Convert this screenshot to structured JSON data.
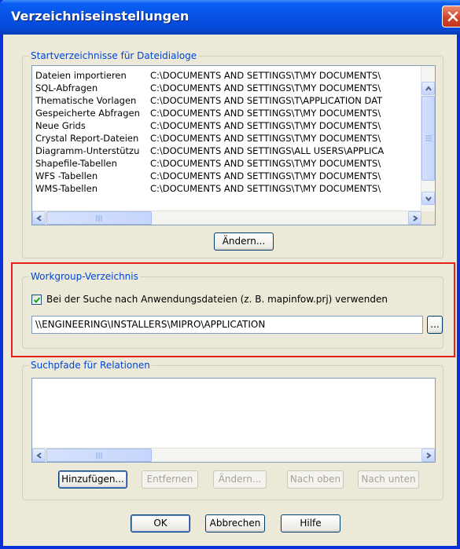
{
  "window": {
    "title": "Verzeichniseinstellungen"
  },
  "start_dirs": {
    "legend": "Startverzeichnisse für Dateidialoge",
    "rows": [
      {
        "name": "Dateien importieren",
        "path": "C:\\DOCUMENTS AND SETTINGS\\T\\MY DOCUMENTS\\"
      },
      {
        "name": "SQL-Abfragen",
        "path": "C:\\DOCUMENTS AND SETTINGS\\T\\MY DOCUMENTS\\"
      },
      {
        "name": "Thematische Vorlagen",
        "path": "C:\\DOCUMENTS AND SETTINGS\\T\\APPLICATION DAT"
      },
      {
        "name": "Gespeicherte Abfragen",
        "path": "C:\\DOCUMENTS AND SETTINGS\\T\\MY DOCUMENTS\\"
      },
      {
        "name": "Neue Grids",
        "path": "C:\\DOCUMENTS AND SETTINGS\\T\\MY DOCUMENTS\\"
      },
      {
        "name": "Crystal Report-Dateien",
        "path": "C:\\DOCUMENTS AND SETTINGS\\T\\MY DOCUMENTS\\"
      },
      {
        "name": "Diagramm-Unterstützu",
        "path": "C:\\DOCUMENTS AND SETTINGS\\ALL USERS\\APPLICA"
      },
      {
        "name": "Shapefile-Tabellen",
        "path": "C:\\DOCUMENTS AND SETTINGS\\T\\MY DOCUMENTS\\"
      },
      {
        "name": "WFS -Tabellen",
        "path": "C:\\DOCUMENTS AND SETTINGS\\T\\MY DOCUMENTS\\"
      },
      {
        "name": "WMS-Tabellen",
        "path": "C:\\DOCUMENTS AND SETTINGS\\T\\MY DOCUMENTS\\"
      }
    ],
    "change_button": "Ändern..."
  },
  "workgroup": {
    "legend": "Workgroup-Verzeichnis",
    "checkbox_label": "Bei der Suche nach Anwendungsdateien (z. B. mapinfow.prj) verwenden",
    "checked": true,
    "path": "\\\\ENGINEERING\\INSTALLERS\\MIPRO\\APPLICATION",
    "browse_button": "..."
  },
  "search_paths": {
    "legend": "Suchpfade für Relationen",
    "buttons": {
      "add": "Hinzufügen...",
      "remove": "Entfernen",
      "change": "Ändern...",
      "up": "Nach oben",
      "down": "Nach unten"
    }
  },
  "footer": {
    "ok": "OK",
    "cancel": "Abbrechen",
    "help": "Hilfe"
  },
  "colors": {
    "titlebar": "#0653e6",
    "legend_text": "#0046d5",
    "highlight_box": "#e8201e"
  }
}
